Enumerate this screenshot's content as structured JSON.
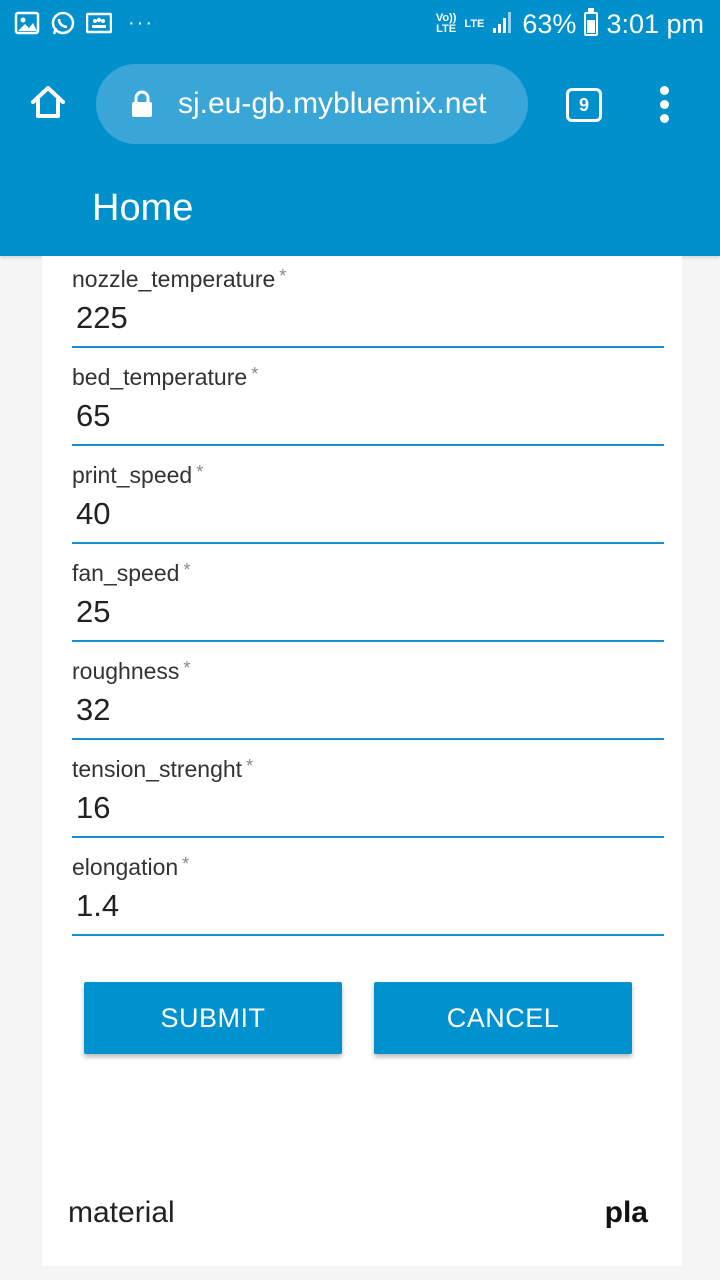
{
  "status_bar": {
    "icons": [
      "gallery-icon",
      "whatsapp-icon",
      "group-icon"
    ],
    "more": "···",
    "volte": "Vo))",
    "volte_sub": "LTE",
    "network": "LTE",
    "battery_percent": "63%",
    "battery_level": 0.63,
    "time": "3:01 pm"
  },
  "browser": {
    "url": "sj.eu-gb.mybluemix.net",
    "tab_count": "9"
  },
  "appbar": {
    "title": "Home"
  },
  "form": {
    "required_mark": "*",
    "fields": [
      {
        "label": "nozzle_temperature",
        "value": "225"
      },
      {
        "label": "bed_temperature",
        "value": "65"
      },
      {
        "label": "print_speed",
        "value": "40"
      },
      {
        "label": "fan_speed",
        "value": "25"
      },
      {
        "label": "roughness",
        "value": "32"
      },
      {
        "label": "tension_strenght",
        "value": "16"
      },
      {
        "label": "elongation",
        "value": "1.4"
      }
    ],
    "submit_label": "SUBMIT",
    "cancel_label": "CANCEL"
  },
  "result": {
    "label": "material",
    "value": "pla"
  },
  "colors": {
    "primary": "#0090cc",
    "url_pill": "#3aa6d8",
    "underline": "#1a8fcf"
  }
}
